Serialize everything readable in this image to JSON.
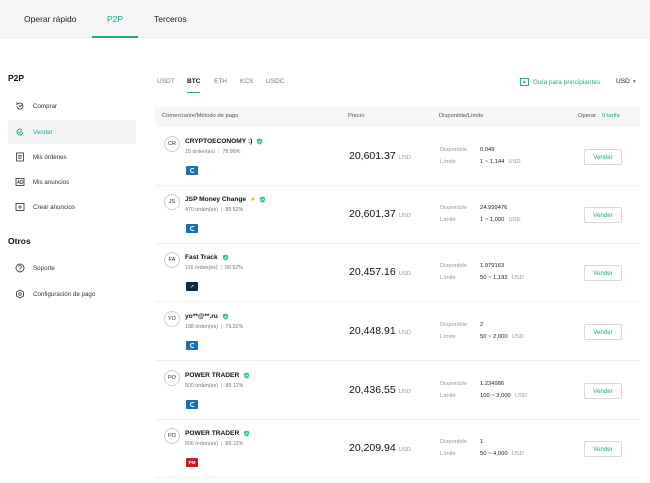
{
  "top_tabs": [
    "Operar rápido",
    "P2P",
    "Terceros"
  ],
  "sidebar": {
    "heading_p2p": "P2P",
    "items": [
      {
        "label": "Comprar",
        "icon": "buy-arrow-icon"
      },
      {
        "label": "Vender",
        "icon": "sell-check-icon"
      },
      {
        "label": "Mis órdenes",
        "icon": "orders-list-icon"
      },
      {
        "label": "Mis anuncios",
        "icon": "ads-icon"
      },
      {
        "label": "Crear anuncios",
        "icon": "create-ad-icon"
      }
    ],
    "heading_otros": "Otros",
    "other_items": [
      {
        "label": "Soporte",
        "icon": "question-icon"
      },
      {
        "label": "Configuración de pago",
        "icon": "gear-icon"
      }
    ]
  },
  "crypto_tabs": [
    "USDT",
    "BTC",
    "ETH",
    "KCS",
    "USDC"
  ],
  "guide_label": "Guía para principiantes",
  "currency": "USD",
  "table": {
    "col_merchant": "Comerciante/Método de pago",
    "col_price": "Precio",
    "col_available": "Disponible/Límite",
    "col_operate": "Operar",
    "fee_label": "0 tarifa",
    "avail_label": "Disponible",
    "limit_label": "Límite",
    "unit": "USD",
    "action_label": "Vender"
  },
  "rows": [
    {
      "initials": "CR",
      "name": "CRYPTOECONOMY :)",
      "orders": "15 órden(es)",
      "rate": "78.96%",
      "pay": "blue",
      "pay_text": "",
      "price": "20,601.37",
      "available": "0.049",
      "limit": "1 ~ 1,144",
      "star": ""
    },
    {
      "initials": "JS",
      "name": "JSP Money Change",
      "orders": "470 órden(es)",
      "rate": "89.52%",
      "pay": "blue",
      "pay_text": "",
      "price": "20,601.37",
      "available": "24.999476",
      "limit": "1 ~ 1,000",
      "star": "★"
    },
    {
      "initials": "FA",
      "name": "Fast Track",
      "orders": "116 órden(es)",
      "rate": "89.92%",
      "pay": "dark",
      "pay_text": "↗",
      "price": "20,457.16",
      "available": "1.979163",
      "limit": "50 ~ 1,192",
      "star": ""
    },
    {
      "initials": "YO",
      "name": "yo**@**.ru",
      "orders": "188 órden(es)",
      "rate": "79.32%",
      "pay": "blue",
      "pay_text": "",
      "price": "20,448.91",
      "available": "2",
      "limit": "50 ~ 2,000",
      "star": ""
    },
    {
      "initials": "PO",
      "name": "POWER TRADER",
      "orders": "500 órden(es)",
      "rate": "89.12%",
      "pay": "blue",
      "pay_text": "",
      "price": "20,436.55",
      "available": "1.234986",
      "limit": "100 ~ 3,000",
      "star": ""
    },
    {
      "initials": "PO",
      "name": "POWER TRADER",
      "orders": "500 órden(es)",
      "rate": "89.12%",
      "pay": "red",
      "pay_text": "PM",
      "price": "20,209.94",
      "available": "1",
      "limit": "50 ~ 4,000",
      "star": ""
    }
  ],
  "colors": {
    "accent": "#22a584",
    "badge_blue": "#1c6fb5",
    "badge_red": "#d01c1c"
  }
}
